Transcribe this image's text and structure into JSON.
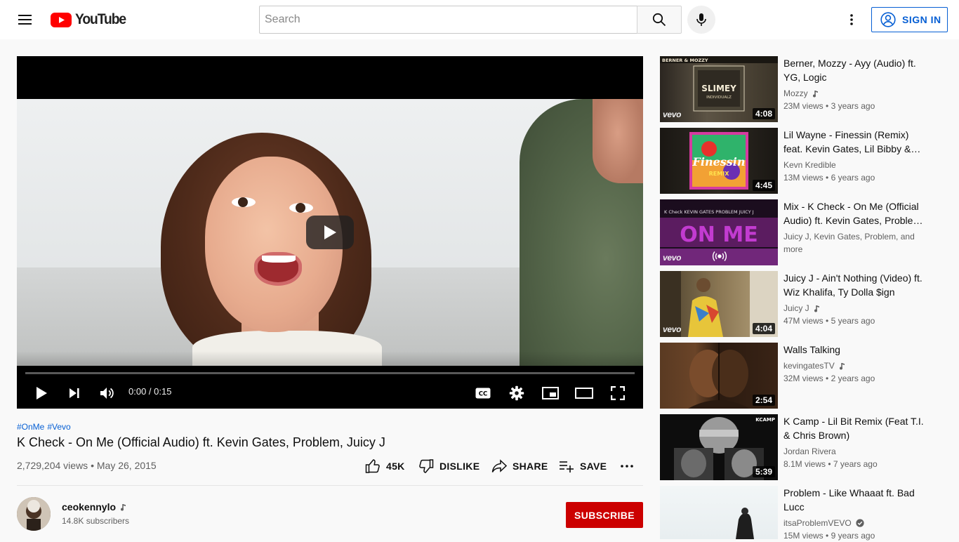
{
  "header": {
    "logo_text": "YouTube",
    "search_placeholder": "Search",
    "sign_in_label": "SIGN IN"
  },
  "player": {
    "time_current": "0:00",
    "time_separator": " / ",
    "time_total": "0:15",
    "progress_fraction": 0
  },
  "video": {
    "hashtags": [
      "#OnMe",
      "#Vevo"
    ],
    "title": "K Check - On Me (Official Audio) ft. Kevin Gates, Problem, Juicy J",
    "views": "2,729,204 views",
    "date": "May 26, 2015",
    "likes": "45K",
    "dislike_label": "DISLIKE",
    "share_label": "SHARE",
    "save_label": "SAVE"
  },
  "channel": {
    "name": "ceokennylo",
    "subscribers": "14.8K subscribers",
    "subscribe_label": "SUBSCRIBE"
  },
  "recommendations": [
    {
      "title": "Berner, Mozzy - Ayy (Audio) ft. YG, Logic",
      "channel": "Mozzy",
      "badge": "music",
      "views": "23M views",
      "age": "3 years ago",
      "duration": "4:08",
      "vevo": "vevo"
    },
    {
      "title": "Lil Wayne - Finessin (Remix) feat. Kevin Gates, Lil Bibby & Fat Trel",
      "channel": "Kevn Kredible",
      "badge": "",
      "views": "13M views",
      "age": "6 years ago",
      "duration": "4:45",
      "vevo": ""
    },
    {
      "title": "Mix - K Check - On Me (Official Audio) ft. Kevin Gates, Problem, Juicy J",
      "channel": "Juicy J, Kevin Gates, Problem, and more",
      "badge": "",
      "views": "",
      "age": "",
      "duration": "",
      "vevo": "vevo"
    },
    {
      "title": "Juicy J - Ain't Nothing (Video) ft. Wiz Khalifa, Ty Dolla $ign",
      "channel": "Juicy J",
      "badge": "music",
      "views": "47M views",
      "age": "5 years ago",
      "duration": "4:04",
      "vevo": "vevo"
    },
    {
      "title": "Walls Talking",
      "channel": "kevingatesTV",
      "badge": "music",
      "views": "32M views",
      "age": "2 years ago",
      "duration": "2:54",
      "vevo": ""
    },
    {
      "title": "K Camp - Lil Bit Remix (Feat T.I. & Chris Brown)",
      "channel": "Jordan Rivera",
      "badge": "",
      "views": "8.1M views",
      "age": "7 years ago",
      "duration": "5:39",
      "vevo": ""
    },
    {
      "title": "Problem - Like Whaaat ft. Bad Lucc",
      "channel": "itsaProblemVEVO",
      "badge": "verified",
      "views": "15M views",
      "age": "9 years ago",
      "duration": "",
      "vevo": ""
    }
  ],
  "thumb_text": {
    "r0_top": "BERNER & MOZZY",
    "r0_art": "SLIMEY",
    "r0_sub": "INDIVIDUALZ",
    "r1_art": "Finessin",
    "r1_sub": "REMIX",
    "r2_names": "K Check   KEVIN GATES   PROBLEM   JUICY J",
    "r2_art": "ON ME",
    "r5_tag": "KCAMP"
  },
  "colors": {
    "accent_blue": "#065fd4",
    "brand_red": "#ff0000",
    "subscribe_red": "#cc0000"
  }
}
